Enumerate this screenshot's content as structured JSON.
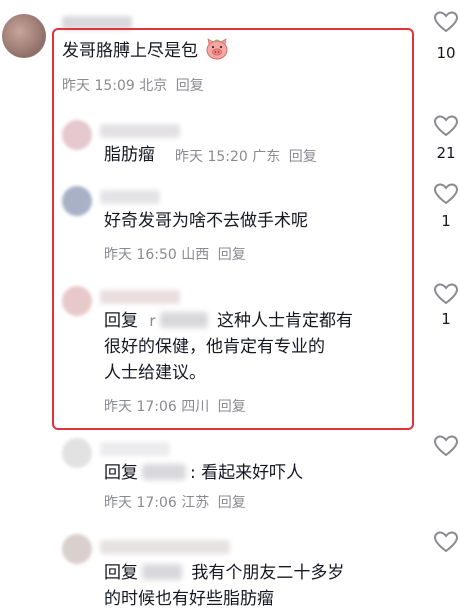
{
  "comments": [
    {
      "text": "发哥胳膊上尽是包",
      "meta_time": "昨天 15:09",
      "meta_location": "北京",
      "reply_label": "回复",
      "likes": "10"
    },
    {
      "text": "脂肪瘤",
      "meta_time": "昨天 15:20",
      "meta_location": "广东",
      "reply_label": "回复",
      "likes": "21"
    },
    {
      "text": "好奇发哥为啥不去做手术呢",
      "meta_time": "昨天 16:50",
      "meta_location": "山西",
      "reply_label": "回复",
      "likes": "1"
    },
    {
      "reply_prefix": "回复",
      "reply_initial": "r",
      "text_line1": "这种人士肯定都有",
      "text_line2": "很好的保健，他肯定有专业的",
      "text_line3": "人士给建议。",
      "meta_time": "昨天 17:06",
      "meta_location": "四川",
      "reply_label": "回复",
      "likes": "1"
    },
    {
      "reply_prefix": "回复",
      "text": ": 看起来好吓人",
      "meta_time": "昨天 17:06",
      "meta_location": "江苏",
      "reply_label": "回复"
    },
    {
      "reply_prefix": "回复",
      "text_line1": "我有个朋友二十多岁",
      "text_line2": "的时候也有好些脂肪瘤"
    }
  ],
  "colors": {
    "highlight_border": "#e5313a",
    "meta_gray": "#8a8b91",
    "text_dark": "#161823"
  },
  "icons": {
    "like": "heart-outline-icon",
    "emoji": "pig-face-emoji"
  }
}
